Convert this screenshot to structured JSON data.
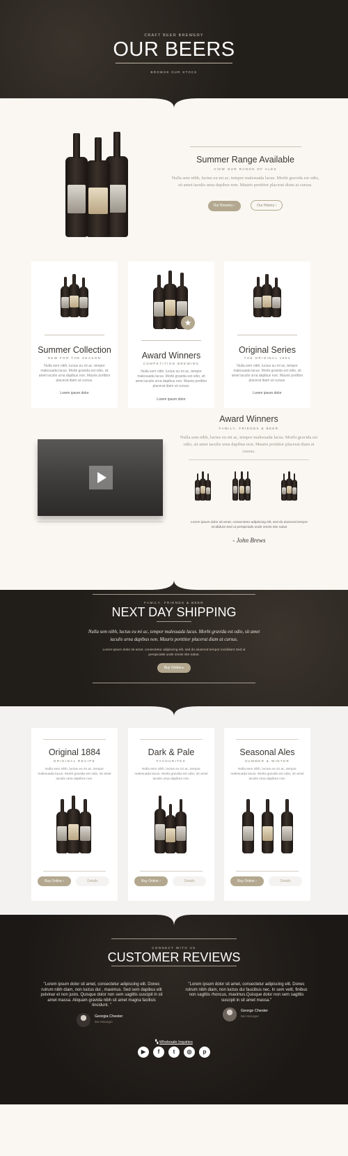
{
  "hero": {
    "pretitle": "CRAFT BEER BREWERY",
    "title": "OUR BEERS",
    "subtitle": "BROWSE OUR STOCK"
  },
  "summer": {
    "title": "Summer Range Available",
    "kicker": "VIEW OUR RANGE OF ALES",
    "text": "Nulla sem nibh, luctus eu mi ac, tempor malesuada lacus. Morbi gravida est odio, sit amet iaculis urna dapibus non. Mauris porttitor placerat diam at cursus.",
    "btn_primary": "Our Brewery ›",
    "btn_secondary": "Our History ›"
  },
  "cards": [
    {
      "title": "Summer Collection",
      "kicker": "NEW FOR THE SEASON",
      "text": "Nulla sem nibh, luctus eu mi ac, tempor malesuada lacus. Morbi gravida est odio, sit amet iaculis urna dapibus non. Mauris porttitor placerat diam at cursus.",
      "cta": "Lorem ipsum dolor"
    },
    {
      "title": "Award Winners",
      "kicker": "COMPETITION BREWING",
      "text": "Nulla sem nibh, luctus eu mi ac, tempor malesuada lacus. Morbi gravida est odio, sit amet iaculis urna dapibus non. Mauris porttitor placerat diam at cursus.",
      "cta": "Lorem ipsum dolor"
    },
    {
      "title": "Original Series",
      "kicker": "THE ORIGINAL 1884",
      "text": "Nulla sem nibh, luctus eu mi ac, tempor malesuada lacus. Morbi gravida est odio, sit amet iaculis urna dapibus non. Mauris porttitor placerat diam at cursus.",
      "cta": "Lorem ipsum dolor"
    }
  ],
  "award": {
    "title": "Award Winners",
    "kicker": "FAMILY, FRIENDS & BEER",
    "text": "Nulla sem nibh, luctus eu mi ac, tempor malesuada lacus. Morbi gravida est odio, sit amet iaculis urna dapibus non. Mauris porttitor placerat diam at cursus.",
    "small_text": "Lorem ipsum dolor sit amet, consectetur adipiscing elit, sed do eiusmod tempor incididunt Sed ut perspiciatis unde omnis iste natus",
    "signature": "- John Brews"
  },
  "shipping": {
    "kicker": "FAMILY, FRIENDS & BEER",
    "title": "NEXT DAY SHIPPING",
    "text": "Nulla sem nibh, luctus eu mi ac, tempor malesuada lacus. Morbi gravida est odio, sit amet iaculis urna dapibus non. Mauris porttitor placerat diam at cursus.",
    "small_text": "Lorem ipsum dolor sit amet, consectetur adipiscing elit, sed do eiusmod tempor incididunt Sed ut perspiciatis unde omnis iste natus.",
    "button": "Buy Online ▸"
  },
  "products": [
    {
      "title": "Original 1884",
      "kicker": "ORIGINAL RECIPE",
      "text": "Nulla sem nibh, luctus eu mi ac, tempor malesuada lacus. Morbi gravida est odio, sit amet iaculis urna dapibus non.",
      "buy": "Buy Online ›",
      "details": "Details"
    },
    {
      "title": "Dark & Pale",
      "kicker": "FAVOURITES",
      "text": "Nulla sem nibh, luctus eu mi ac, tempor malesuada lacus. Morbi gravida est odio, sit amet iaculis urna dapibus non.",
      "buy": "Buy Online ›",
      "details": "Details"
    },
    {
      "title": "Seasonal Ales",
      "kicker": "SUMMER & WINTER",
      "text": "Nulla sem nibh, luctus eu mi ac, tempor malesuada lacus. Morbi gravida est odio, sit amet iaculis urna dapibus non.",
      "buy": "Buy Online ›",
      "details": "Details"
    }
  ],
  "reviews": {
    "kicker": "CONNECT WITH US",
    "title": "CUSTOMER REVIEWS",
    "items": [
      {
        "quote": "\"Lorem ipsum dolor sit amet, consectetur adipiscing elit. Donec rutrum nibh diam, non luctus dui , maximus. Sed sem dapibus elit pulvinar et non justo. Quisque dolor non sem sagittis suscipit in sit amet massa. Aliquam gravida nibh sit amet magna facilisis tincidunt. \"",
        "name": "Georgia Chester",
        "role": "Bar Manager"
      },
      {
        "quote": "\"Lorem ipsum dolor sit amet, consectetur adipiscing elit. Donec rutrum nibh diam, non luctus dui faucibus nec. In sem velit, finibus non sagittis rhoncus, maximus.Quisque dolor non sem sagittis suscipit in sit amet massa.\"",
        "name": "George Chester",
        "role": "Bar Manager"
      }
    ]
  },
  "footer": {
    "link": "Wholesale Inquiries",
    "social": [
      "youtube-icon",
      "facebook-icon",
      "twitter-icon",
      "instagram-icon",
      "pinterest-icon"
    ]
  }
}
